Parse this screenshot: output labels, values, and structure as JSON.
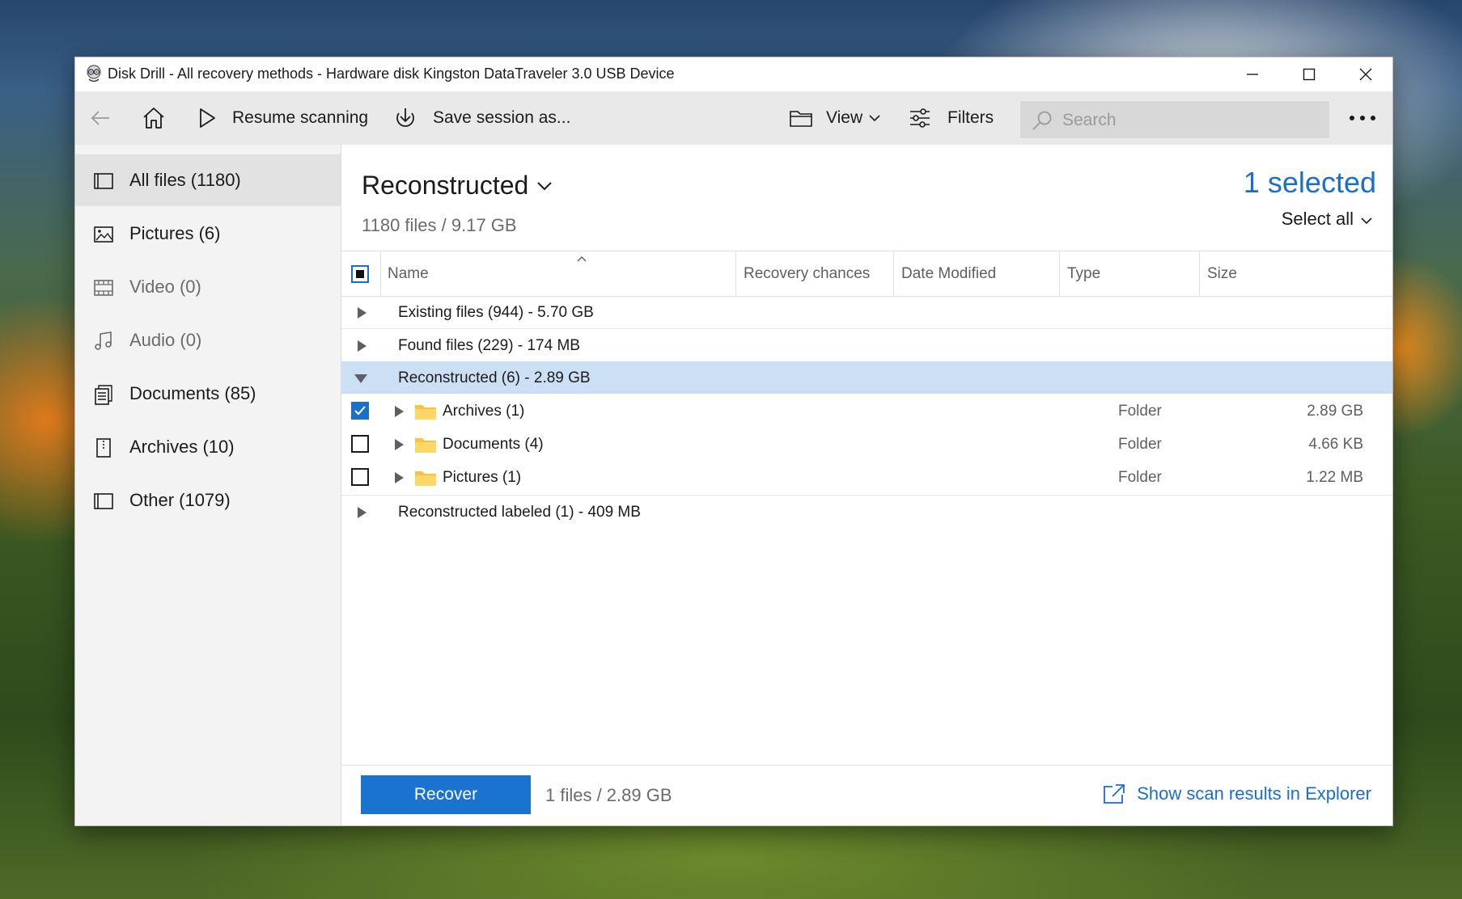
{
  "window": {
    "title": "Disk Drill - All recovery methods - Hardware disk Kingston DataTraveler 3.0 USB Device",
    "app_icon": "disk-drill-logo"
  },
  "toolbar": {
    "resume_label": "Resume scanning",
    "save_label": "Save session as...",
    "view_label": "View",
    "filters_label": "Filters",
    "search_placeholder": "Search",
    "search_value": ""
  },
  "sidebar": {
    "items": [
      {
        "label": "All files (1180)",
        "icon": "all-files-icon",
        "active": true
      },
      {
        "label": "Pictures (6)",
        "icon": "pictures-icon"
      },
      {
        "label": "Video (0)",
        "icon": "video-icon"
      },
      {
        "label": "Audio (0)",
        "icon": "audio-icon"
      },
      {
        "label": "Documents (85)",
        "icon": "documents-icon"
      },
      {
        "label": "Archives (10)",
        "icon": "archives-icon"
      },
      {
        "label": "Other (1079)",
        "icon": "other-icon"
      }
    ]
  },
  "main": {
    "heading": "Reconstructed",
    "summary": "1180 files / 9.17 GB",
    "selected_count": "1 selected",
    "select_all": "Select all"
  },
  "table": {
    "columns": [
      "Name",
      "Recovery chances",
      "Date Modified",
      "Type",
      "Size"
    ],
    "groups": [
      {
        "label": "Existing files (944) - 5.70 GB",
        "expanded": false
      },
      {
        "label": "Found files (229) - 174 MB",
        "expanded": false
      },
      {
        "label": "Reconstructed (6) - 2.89 GB",
        "expanded": true,
        "selected": true
      },
      {
        "label": "Reconstructed labeled (1) - 409 MB",
        "expanded": false
      }
    ],
    "children": [
      {
        "name": "Archives (1)",
        "type": "Folder",
        "size": "2.89 GB",
        "checked": true
      },
      {
        "name": "Documents (4)",
        "type": "Folder",
        "size": "4.66 KB",
        "checked": false
      },
      {
        "name": "Pictures (1)",
        "type": "Folder",
        "size": "1.22 MB",
        "checked": false
      }
    ]
  },
  "footer": {
    "recover_label": "Recover",
    "selection_info": "1 files / 2.89 GB",
    "explorer_link": "Show scan results in Explorer"
  },
  "colors": {
    "accent": "#1a6fc9",
    "button": "#1a72d1",
    "selected_row": "#cce0f5",
    "folder": "#f5c542"
  }
}
